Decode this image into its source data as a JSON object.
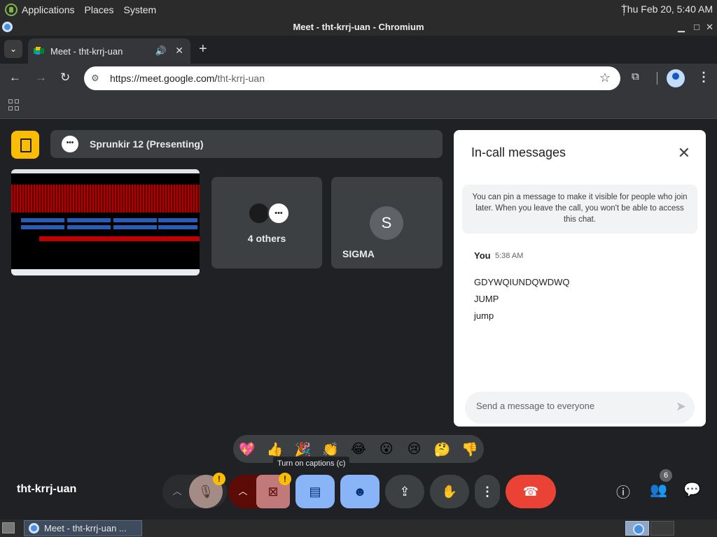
{
  "os": {
    "menus": [
      "Applications",
      "Places",
      "System"
    ],
    "clock": "Thu Feb 20,  5:40 AM",
    "window_title": "Meet - tht-krrj-uan - Chromium",
    "window_controls": [
      "minimize-icon",
      "maximize-icon",
      "close-icon"
    ],
    "taskbar_item": "Meet - tht-krrj-uan ..."
  },
  "browser": {
    "tab_title": "Meet - tht-krrj-uan",
    "url_host": "https://meet.google.com/",
    "url_path": "tht-krrj-uan",
    "icons": [
      "back-icon",
      "forward-icon",
      "reload-icon",
      "star-icon",
      "extensions-icon",
      "profile-icon",
      "menu-icon",
      "apps-icon"
    ]
  },
  "meet": {
    "presenter_label": "Sprunkir 12 (Presenting)",
    "others_label": "4 others",
    "participant_initial": "S",
    "participant_name": "SIGMA",
    "meeting_code": "tht-krrj-uan",
    "people_count": "6",
    "reactions": [
      "💖",
      "👍",
      "🎉",
      "👏",
      "😂",
      "😮",
      "😢",
      "🤔",
      "👎"
    ],
    "tooltip": "Turn on captions (c)"
  },
  "chat": {
    "title": "In-call messages",
    "pin_notice": "You can pin a message to make it visible for people who join later. When you leave the call, you won't be able to access this chat.",
    "sender": "You",
    "time": "5:38 AM",
    "messages": [
      "GDYWQIUNDQWDWQ",
      "JUMP",
      "jump"
    ],
    "input_placeholder": "Send a message to everyone"
  },
  "colors": {
    "background": "#202124",
    "hangup": "#ea4335",
    "warning": "#fbbc04",
    "active_button": "#8ab4f8",
    "panel": "#ffffff"
  }
}
